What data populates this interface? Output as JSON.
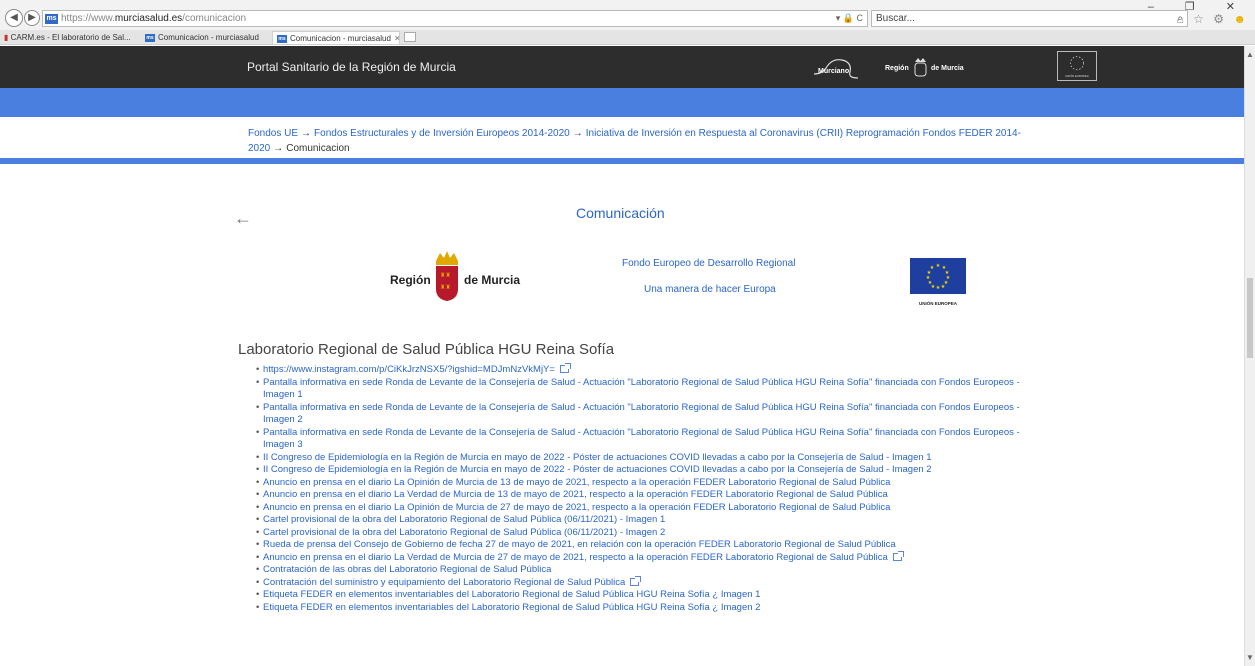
{
  "browser": {
    "url_prefix": "https://www.",
    "url_domain": "murciasalud.es",
    "url_path": "/comunicacion",
    "favicon_text": "ms",
    "search_placeholder": "Buscar...",
    "search_icon": "⌕",
    "addr_icons": "▾ 🔒 C",
    "window_controls": "–  ❐  ✕",
    "tool_icons": "⌂ ☆ ⚙",
    "tabs": [
      {
        "label": "CARM.es - El laboratorio de Sal..."
      },
      {
        "label": "Comunicacion - murciasalud"
      },
      {
        "label": "Comunicacion - murciasalud"
      }
    ]
  },
  "header": {
    "site_title": "Portal Sanitario de la Región de Murcia",
    "logo_murciano": "Murciano",
    "logo_region_left": "Región",
    "logo_region_right": "de Murcia",
    "eu_label": "UNIÓN EUROPEA"
  },
  "breadcrumb": {
    "items": [
      "Fondos UE",
      "Fondos Estructurales y de Inversión Europeos 2014-2020",
      "Iniciativa de Inversión en Respuesta al Coronavirus (CRII) Reprogramación Fondos FEDER 2014-2020"
    ],
    "current": "Comunicacion",
    "separator": "→"
  },
  "content": {
    "back_arrow": "←",
    "title": "Comunicación",
    "logo_region_left": "Región",
    "logo_region_right": "de Murcia",
    "fondo": "Fondo Europeo de Desarrollo Regional",
    "manera": "Una manera de hacer Europa",
    "eu_label": "UNIÓN EUROPEA",
    "section_title": "Laboratorio Regional de Salud Pública HGU Reina Sofía",
    "links": [
      {
        "text": "https://www.instagram.com/p/CiKkJrzNSX5/?igshid=MDJmNzVkMjY=",
        "external": true
      },
      {
        "text": "Pantalla informativa en sede Ronda de Levante de la Consejería de Salud - Actuación \"Laboratorio Regional de Salud Pública HGU Reina Sofía\" financiada con Fondos Europeos - Imagen 1",
        "external": false
      },
      {
        "text": "Pantalla informativa en sede Ronda de Levante de la Consejería de Salud - Actuación \"Laboratorio Regional de Salud Pública HGU Reina Sofía\" financiada con Fondos Europeos - Imagen 2",
        "external": false
      },
      {
        "text": "Pantalla informativa en sede Ronda de Levante de la Consejería de Salud - Actuación \"Laboratorio Regional de Salud Pública HGU Reina Sofía\" financiada con Fondos Europeos - Imagen 3",
        "external": false
      },
      {
        "text": "II Congreso de Epidemiología en la Región de Murcia en mayo de 2022 - Póster de actuaciones COVID llevadas a cabo por la Consejería de Salud - Imagen 1",
        "external": false
      },
      {
        "text": "II Congreso de Epidemiología en la Región de Murcia en mayo de 2022 - Póster de actuaciones COVID llevadas a cabo por la Consejería de Salud - Imagen 2",
        "external": false
      },
      {
        "text": "Anuncio en prensa en el diario La Opinión de Murcia de 13 de mayo de 2021, respecto a la operación FEDER Laboratorio Regional de Salud Pública",
        "external": false
      },
      {
        "text": "Anuncio en prensa en el diario La Verdad de Murcia de 13 de mayo de 2021, respecto a la operación FEDER Laboratorio Regional de Salud Pública",
        "external": false
      },
      {
        "text": "Anuncio en prensa en el diario La Opinión de Murcia de 27 de mayo de 2021, respecto a la operación FEDER Laboratorio Regional de Salud Pública",
        "external": false
      },
      {
        "text": "Cartel provisional de la obra del Laboratorio Regional de Salud Pública (06/11/2021) - Imagen 1",
        "external": false
      },
      {
        "text": "Cartel provisional de la obra del Laboratorio Regional de Salud Pública (06/11/2021) - Imagen 2",
        "external": false
      },
      {
        "text": "Rueda de prensa del Consejo de Gobierno de fecha 27 de mayo de 2021, en relación con la operación FEDER Laboratorio Regional de Salud Pública",
        "external": false
      },
      {
        "text": "Anuncio en prensa en el diario La Verdad de Murcia de 27 de mayo de 2021, respecto a la operación FEDER Laboratorio Regional de Salud Pública",
        "external": true
      },
      {
        "text": "Contratación de las obras del Laboratorio Regional de Salud Pública",
        "external": false
      },
      {
        "text": "Contratación del suministro y equipamiento del Laboratorio Regional de Salud Pública",
        "external": true
      },
      {
        "text": "Etiqueta FEDER en elementos inventariables del Laboratorio Regional de Salud Pública HGU Reina Sofía ¿ Imagen 1",
        "external": false
      },
      {
        "text": "Etiqueta FEDER en elementos inventariables del Laboratorio Regional de Salud Pública HGU Reina Sofía ¿ Imagen 2",
        "external": false
      }
    ]
  },
  "colors": {
    "link": "#2a66c9",
    "band": "#4a7fe0",
    "header_bg": "#2d2d2d",
    "murcia_red": "#b8182c",
    "crown_gold": "#e0a800",
    "eu_blue": "#1f3f9e",
    "eu_star": "#ffd800"
  }
}
